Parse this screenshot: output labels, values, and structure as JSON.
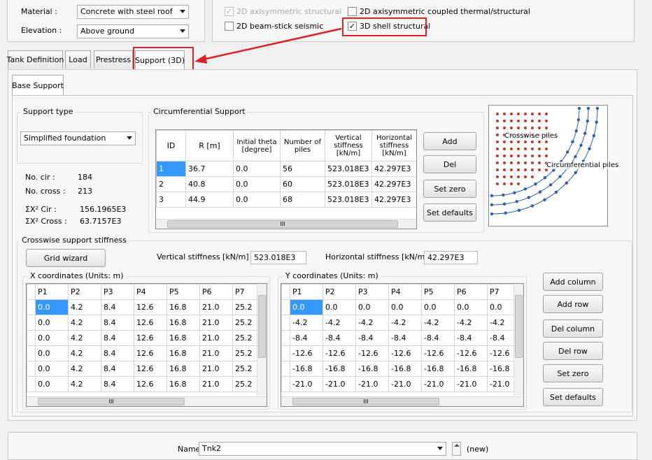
{
  "top": {
    "material_label": "Material :",
    "material_value": "Concrete with steel roof",
    "elevation_label": "Elevation :",
    "elevation_value": "Above ground",
    "models": [
      {
        "label": "2D axisymmetric structural",
        "checked": true,
        "disabled": true
      },
      {
        "label": "2D beam-stick seismic",
        "checked": false,
        "disabled": false
      },
      {
        "label": "2D axisymmetric coupled thermal/structural",
        "checked": false,
        "disabled": false
      },
      {
        "label": "3D shell structural",
        "checked": true,
        "disabled": false
      }
    ]
  },
  "tabs": [
    "Tank Definition",
    "Load",
    "Prestress",
    "Support (3D)"
  ],
  "subtab": "Base Support",
  "support_type": {
    "label": "Support type",
    "value": "Simplified foundation"
  },
  "stats": {
    "no_cir_label": "No. cir :",
    "no_cir": "184",
    "no_cross_label": "No. cross :",
    "no_cross": "213",
    "sum_cir_label": "ΣX² Cir :",
    "sum_cir": "156.1965E3",
    "sum_cross_label": "ΣX² Cross :",
    "sum_cross": "63.7157E3"
  },
  "circ": {
    "title": "Circumferential Support",
    "headers": [
      "ID",
      "R [m]",
      "Initial theta [degree]",
      "Number of piles",
      "Vertical stiffness [kN/m]",
      "Horizontal stiffness [kN/m]"
    ],
    "rows": [
      [
        "1",
        "36.7",
        "0.0",
        "56",
        "523.018E3",
        "42.297E3"
      ],
      [
        "2",
        "40.8",
        "0.0",
        "60",
        "523.018E3",
        "42.297E3"
      ],
      [
        "3",
        "44.9",
        "0.0",
        "68",
        "523.018E3",
        "42.297E3"
      ]
    ],
    "buttons": [
      "Add",
      "Del",
      "Set zero",
      "Set defaults"
    ]
  },
  "diagram": {
    "crosswise_label": "Crosswise piles",
    "circ_label": "Circumferential piles"
  },
  "cross": {
    "title": "Crosswise support stiffness",
    "grid_wizard": "Grid wizard",
    "vert_label": "Vertical stiffness [kN/m]",
    "vert_value": "523.018E3",
    "horiz_label": "Horizontal stiffness [kN/m]",
    "horiz_value": "42.297E3",
    "x_title": "X coordinates (Units: m)",
    "y_title": "Y coordinates (Units: m)",
    "headers": [
      "P1",
      "P2",
      "P3",
      "P4",
      "P5",
      "P6",
      "P7"
    ],
    "x_rows": [
      [
        "0.0",
        "4.2",
        "8.4",
        "12.6",
        "16.8",
        "21.0",
        "25.2"
      ],
      [
        "0.0",
        "4.2",
        "8.4",
        "12.6",
        "16.8",
        "21.0",
        "25.2"
      ],
      [
        "0.0",
        "4.2",
        "8.4",
        "12.6",
        "16.8",
        "21.0",
        "25.2"
      ],
      [
        "0.0",
        "4.2",
        "8.4",
        "12.6",
        "16.8",
        "21.0",
        "25.2"
      ],
      [
        "0.0",
        "4.2",
        "8.4",
        "12.6",
        "16.8",
        "21.0",
        "25.2"
      ],
      [
        "0.0",
        "4.2",
        "8.4",
        "12.6",
        "16.8",
        "21.0",
        "25.2"
      ]
    ],
    "y_rows": [
      [
        "0.0",
        "0.0",
        "0.0",
        "0.0",
        "0.0",
        "0.0",
        "0.0"
      ],
      [
        "-4.2",
        "-4.2",
        "-4.2",
        "-4.2",
        "-4.2",
        "-4.2",
        "-4.2"
      ],
      [
        "-8.4",
        "-8.4",
        "-8.4",
        "-8.4",
        "-8.4",
        "-8.4",
        "-8.4"
      ],
      [
        "-12.6",
        "-12.6",
        "-12.6",
        "-12.6",
        "-12.6",
        "-12.6",
        "-12.6"
      ],
      [
        "-16.8",
        "-16.8",
        "-16.8",
        "-16.8",
        "-16.8",
        "-16.8",
        "-16.8"
      ],
      [
        "-21.0",
        "-21.0",
        "-21.0",
        "-21.0",
        "-21.0",
        "-21.0",
        "-21.0"
      ]
    ],
    "side_buttons": [
      "Add column",
      "Add row",
      "Del column",
      "Del row",
      "Set zero",
      "Set defaults"
    ]
  },
  "footer": {
    "name_label": "Name",
    "name_value": "Tnk2",
    "status": "(new)"
  },
  "scroll_glyph": "III",
  "colors": {
    "highlight": "#d9222a",
    "selection": "#3399ff",
    "pile": "#c0392b",
    "ring": "#2e5fa8"
  }
}
